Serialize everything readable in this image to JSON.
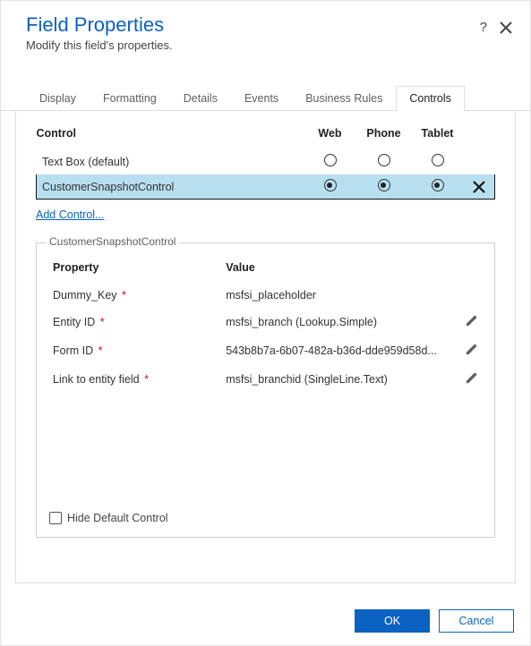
{
  "dialog": {
    "title": "Field Properties",
    "subtitle": "Modify this field's properties."
  },
  "tabs": [
    "Display",
    "Formatting",
    "Details",
    "Events",
    "Business Rules",
    "Controls"
  ],
  "active_tab": "Controls",
  "controls_table": {
    "headers": {
      "control": "Control",
      "web": "Web",
      "phone": "Phone",
      "tablet": "Tablet"
    },
    "rows": [
      {
        "name": "Text Box (default)",
        "web": false,
        "phone": false,
        "tablet": false,
        "selected": false,
        "removable": false
      },
      {
        "name": "CustomerSnapshotControl",
        "web": true,
        "phone": true,
        "tablet": true,
        "selected": true,
        "removable": true
      }
    ],
    "add_link": "Add Control..."
  },
  "control_details": {
    "legend": "CustomerSnapshotControl",
    "headers": {
      "property": "Property",
      "value": "Value"
    },
    "properties": [
      {
        "name": "Dummy_Key",
        "required": true,
        "value": "msfsi_placeholder",
        "editable": false
      },
      {
        "name": "Entity ID",
        "required": true,
        "value": "msfsi_branch (Lookup.Simple)",
        "editable": true
      },
      {
        "name": "Form ID",
        "required": true,
        "value": "543b8b7a-6b07-482a-b36d-dde959d58d...",
        "editable": true
      },
      {
        "name": "Link to entity field",
        "required": true,
        "value": "msfsi_branchid (SingleLine.Text)",
        "editable": true
      }
    ],
    "hide_default_label": "Hide Default Control",
    "hide_default_checked": false
  },
  "buttons": {
    "ok": "OK",
    "cancel": "Cancel"
  }
}
